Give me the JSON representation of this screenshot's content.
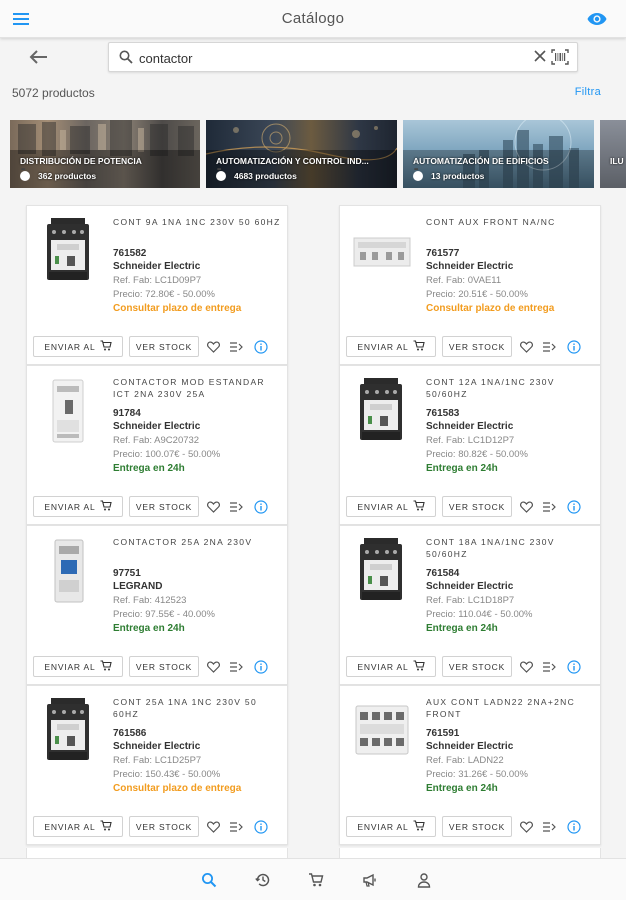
{
  "app": {
    "title": "Catálogo"
  },
  "search": {
    "value": "contactor",
    "placeholder": ""
  },
  "results": {
    "count_label": "5072 productos",
    "filter_label": "Filtra"
  },
  "categories": [
    {
      "title": "DISTRIBUCIÓN DE POTENCIA",
      "count": "362 productos"
    },
    {
      "title": "AUTOMATIZACIÓN Y CONTROL IND...",
      "count": "4683 productos"
    },
    {
      "title": "AUTOMATIZACIÓN DE EDIFICIOS",
      "count": "13 productos"
    },
    {
      "title": "ILU",
      "count": ""
    }
  ],
  "buttons": {
    "send": "ENVIAR AL",
    "stock": "VER STOCK"
  },
  "products": [
    {
      "name": "CONT 9A 1NA 1NC 230V 50 60HZ",
      "code": "761582",
      "brand": "Schneider Electric",
      "ref": "Ref. Fab: LC1D09P7",
      "price": "Precio: 72.80€ - 50.00%",
      "availability": "Consultar plazo de entrega",
      "avail_type": "orange",
      "image": "contactor"
    },
    {
      "name": "CONT AUX FRONT NA/NC",
      "code": "761577",
      "brand": "Schneider Electric",
      "ref": "Ref. Fab: 0VAE11",
      "price": "Precio: 20.51€ - 50.00%",
      "availability": "Consultar plazo de entrega",
      "avail_type": "orange",
      "image": "aux-block"
    },
    {
      "name": "CONTACTOR MOD ESTANDAR ICT 2NA 230V 25A",
      "code": "91784",
      "brand": "Schneider Electric",
      "ref": "Ref. Fab: A9C20732",
      "price": "Precio: 100.07€ - 50.00%",
      "availability": "Entrega en 24h",
      "avail_type": "green",
      "image": "modular"
    },
    {
      "name": "CONT 12A 1NA/1NC 230V 50/60HZ",
      "code": "761583",
      "brand": "Schneider Electric",
      "ref": "Ref. Fab: LC1D12P7",
      "price": "Precio: 80.82€ - 50.00%",
      "availability": "Entrega en 24h",
      "avail_type": "green",
      "image": "contactor"
    },
    {
      "name": "CONTACTOR 25A 2NA 230V",
      "code": "97751",
      "brand": "LEGRAND",
      "ref": "Ref. Fab: 412523",
      "price": "Precio: 97.55€ - 40.00%",
      "availability": "Entrega en 24h",
      "avail_type": "green",
      "image": "modular-gray"
    },
    {
      "name": "CONT 18A 1NA/1NC 230V 50/60HZ",
      "code": "761584",
      "brand": "Schneider Electric",
      "ref": "Ref. Fab: LC1D18P7",
      "price": "Precio: 110.04€ - 50.00%",
      "availability": "Entrega en 24h",
      "avail_type": "green",
      "image": "contactor"
    },
    {
      "name": "CONT 25A 1NA 1NC 230V 50 60HZ",
      "code": "761586",
      "brand": "Schneider Electric",
      "ref": "Ref. Fab: LC1D25P7",
      "price": "Precio: 150.43€ - 50.00%",
      "availability": "Consultar plazo de entrega",
      "avail_type": "orange",
      "image": "contactor"
    },
    {
      "name": "AUX CONT LADN22 2NA+2NC FRONT",
      "code": "761591",
      "brand": "Schneider Electric",
      "ref": "Ref. Fab: LADN22",
      "price": "Precio: 31.26€ - 50.00%",
      "availability": "Entrega en 24h",
      "avail_type": "green",
      "image": "aux-front"
    }
  ],
  "nav": [
    "search-icon",
    "history-icon",
    "cart-icon",
    "megaphone-icon",
    "user-icon"
  ],
  "colors": {
    "accent": "#2196f3",
    "orange": "#f29c1f",
    "green": "#2e7d32"
  }
}
